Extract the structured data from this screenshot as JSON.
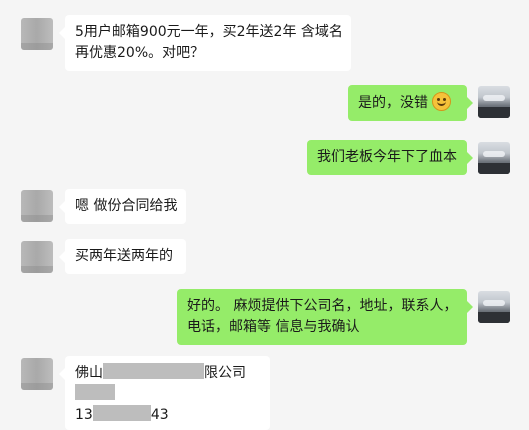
{
  "chat": {
    "messages": [
      {
        "side": "left",
        "lines": [
          "5用户邮箱900元一年，买2年送2年 含域名",
          "再优惠20%。对吧？"
        ]
      },
      {
        "side": "right",
        "text": "是的，没错",
        "emoji": "smiley-emoji"
      },
      {
        "side": "right",
        "text": "我们老板今年下了血本"
      },
      {
        "side": "left",
        "text": "嗯 做份合同给我"
      },
      {
        "side": "left",
        "text": "买两年送两年的"
      },
      {
        "side": "right",
        "lines": [
          "好的。 麻烦提供下公司名，地址，联系人，",
          "电话，邮箱等 信息与我确认"
        ]
      },
      {
        "side": "left",
        "line1_prefix": "佛山",
        "line1_suffix": "限公司",
        "line3_prefix": "13",
        "line3_suffix": "43"
      }
    ]
  }
}
